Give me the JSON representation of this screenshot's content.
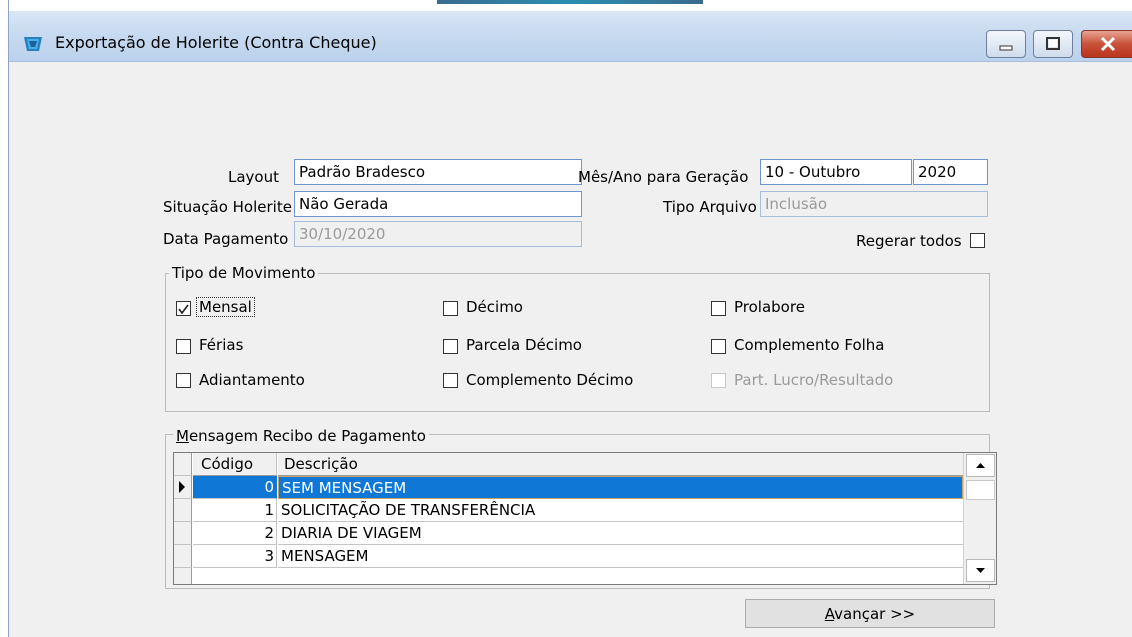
{
  "window": {
    "title": "Exportação de Holerite (Contra Cheque)",
    "icon": "app-icon"
  },
  "form": {
    "layout_label": "Layout",
    "layout_value": "Padrão Bradesco",
    "situacao_label": "Situação Holerite",
    "situacao_value": "Não Gerada",
    "data_pagamento_label": "Data Pagamento",
    "data_pagamento_value": "30/10/2020",
    "mes_ano_label": "Mês/Ano para Geração",
    "mes_value": "10 - Outubro",
    "ano_value": "2020",
    "tipo_arquivo_label": "Tipo Arquivo",
    "tipo_arquivo_value": "Inclusão",
    "regerar_label": "Regerar todos",
    "regerar_checked": false
  },
  "tipo_movimento": {
    "legend": "Tipo de Movimento",
    "items": [
      {
        "label": "Mensal",
        "checked": true,
        "enabled": true
      },
      {
        "label": "Férias",
        "checked": false,
        "enabled": true
      },
      {
        "label": "Adiantamento",
        "checked": false,
        "enabled": true
      },
      {
        "label": "Décimo",
        "checked": false,
        "enabled": true
      },
      {
        "label": "Parcela Décimo",
        "checked": false,
        "enabled": true
      },
      {
        "label": "Complemento Décimo",
        "checked": false,
        "enabled": true
      },
      {
        "label": "Prolabore",
        "checked": false,
        "enabled": true
      },
      {
        "label": "Complemento Folha",
        "checked": false,
        "enabled": true
      },
      {
        "label": "Part. Lucro/Resultado",
        "checked": false,
        "enabled": false
      }
    ]
  },
  "mensagem": {
    "legend_accel": "M",
    "legend_rest": "ensagem Recibo de Pagamento",
    "columns": [
      "Código",
      "Descrição"
    ],
    "rows": [
      {
        "codigo": "0",
        "descricao": "SEM MENSAGEM",
        "selected": true
      },
      {
        "codigo": "1",
        "descricao": "SOLICITAÇÃO DE TRANSFERÊNCIA",
        "selected": false
      },
      {
        "codigo": "2",
        "descricao": "DIARIA DE VIAGEM",
        "selected": false
      },
      {
        "codigo": "3",
        "descricao": "MENSAGEM",
        "selected": false
      }
    ]
  },
  "buttons": {
    "avancar_accel": "A",
    "avancar_rest": "vançar >>"
  },
  "colors": {
    "selection": "#0f78d7",
    "title_bar": "#c5d8ef",
    "close_button": "#c9513a",
    "window_bg": "#f0f0f0"
  }
}
